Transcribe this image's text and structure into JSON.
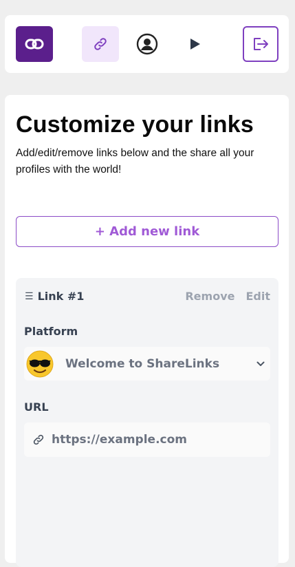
{
  "header": {
    "logo_icon": "chain-link-icon",
    "nav": [
      {
        "icon": "link-icon",
        "active": true
      },
      {
        "icon": "user-circle-icon",
        "active": false
      },
      {
        "icon": "play-icon",
        "active": false
      }
    ],
    "logout_icon": "logout-icon"
  },
  "main": {
    "title": "Customize your links",
    "subtitle": "Add/edit/remove links below and the share all your profiles with the world!",
    "add_button_label": "+ Add new link"
  },
  "link_card": {
    "heading": "Link #1",
    "remove_label": "Remove",
    "edit_label": "Edit",
    "platform_label": "Platform",
    "platform_selected": "Welcome to ShareLinks",
    "platform_icon": "sunglasses-face-icon",
    "url_label": "URL",
    "url_placeholder": "https://example.com"
  },
  "colors": {
    "brand": "#5b1f8c",
    "accent": "#a05ad6",
    "active_nav_bg": "#f1e6fb",
    "page_bg": "#efefef"
  }
}
